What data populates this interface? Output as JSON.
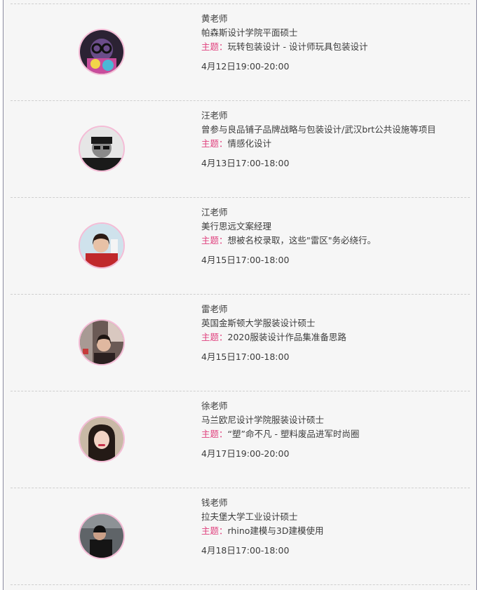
{
  "topic_label": "主题：",
  "teachers": [
    {
      "name": "黄老师",
      "title": "帕森斯设计学院平面硕士",
      "topic": "玩转包装设计 - 设计师玩具包装设计",
      "time": "4月12日19:00-20:00"
    },
    {
      "name": "汪老师",
      "title": "曾参与良品铺子品牌战略与包装设计/武汉brt公共设施等项目",
      "topic": "情感化设计",
      "time": "4月13日17:00-18:00"
    },
    {
      "name": "江老师",
      "title": "美行思远文案经理",
      "topic": "想被名校录取，这些\"雷区\"务必绕行。",
      "time": "4月15日17:00-18:00"
    },
    {
      "name": "雷老师",
      "title": "英国金斯顿大学服装设计硕士",
      "topic": "2020服装设计作品集准备思路",
      "time": "4月15日17:00-18:00"
    },
    {
      "name": "徐老师",
      "title": "马兰欧尼设计学院服装设计硕士",
      "topic": "“塑”命不凡 - 塑料废品进军时尚圈",
      "time": "4月17日19:00-20:00"
    },
    {
      "name": "钱老师",
      "title": "拉夫堡大学工业设计硕士",
      "topic": "rhino建模与3D建模使用",
      "time": "4月18日17:00-18:00"
    }
  ],
  "colors": {
    "topic_accent": "#e0417e",
    "avatar_ring": "#f4bcd6",
    "background": "#f6f6f6"
  }
}
